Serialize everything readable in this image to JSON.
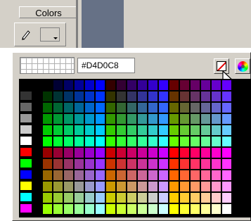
{
  "panel": {
    "title": "Colors",
    "pencil_icon": "pencil-icon",
    "stroke_color": "#d4d0c8"
  },
  "popup": {
    "hex_value": "#D4D0C8",
    "no_color_icon": "no-color-icon",
    "color_wheel_icon": "color-wheel-icon",
    "cursor_icon": "pointer-cursor-icon"
  },
  "palette": {
    "left_swatches": [
      "#000000",
      "#333333",
      "#666666",
      "#999999",
      "#cccccc",
      "#ffffff",
      "#ff0000",
      "#00ff00",
      "#0000ff",
      "#ffff00",
      "#00ffff",
      "#ff00ff"
    ],
    "web_safe_steps": [
      "00",
      "33",
      "66",
      "99",
      "CC",
      "FF"
    ]
  }
}
